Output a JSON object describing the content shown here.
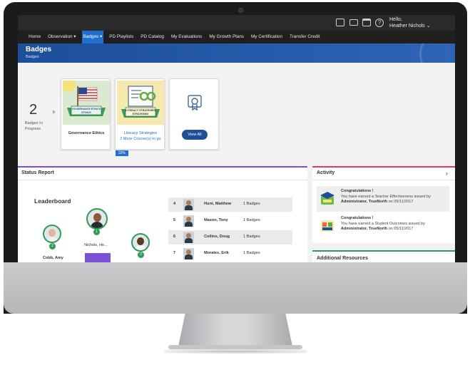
{
  "topbar": {
    "greeting": "Hello,",
    "user_name": "Heather Nichols",
    "help_glyph": "?"
  },
  "nav": {
    "items": [
      {
        "label": "Home"
      },
      {
        "label": "Observation ▾"
      },
      {
        "label": "Badges ▾",
        "active": true
      },
      {
        "label": "PD Playlists"
      },
      {
        "label": "PD Catalog"
      },
      {
        "label": "My Evaluations"
      },
      {
        "label": "My Growth Plans"
      },
      {
        "label": "My Certification"
      },
      {
        "label": "Transfer Credit"
      }
    ]
  },
  "banner": {
    "title": "Badges",
    "breadcrumb": "Badges"
  },
  "badges_in_progress": {
    "count": "2",
    "label": "Badges In Progress"
  },
  "badge_cards": [
    {
      "name": "Governance Ethics",
      "ribbon": "GOVERNANCE ETHICS"
    },
    {
      "name": "Literacy Strategies",
      "note": "2 More Course(s) to go",
      "progress": "33%",
      "ribbon": "LITERACY STRATEGIES"
    }
  ],
  "view_all": {
    "label": "View All"
  },
  "status_report": {
    "title": "Status Report",
    "leaderboard_title": "Leaderboard",
    "podium": [
      {
        "rank": "1",
        "name": "Nichols, He..."
      },
      {
        "rank": "2",
        "name": "Cobb, Amy"
      },
      {
        "rank": "3",
        "name": ""
      }
    ],
    "ranking": [
      {
        "rank": "4",
        "name": "Hunt, Matthew",
        "badges": "1 Badges"
      },
      {
        "rank": "5",
        "name": "Mason, Tony",
        "badges": "1 Badges"
      },
      {
        "rank": "6",
        "name": "Collins, Doug",
        "badges": "1 Badges"
      },
      {
        "rank": "7",
        "name": "Morales, Erik",
        "badges": "1 Badges"
      }
    ]
  },
  "activity": {
    "title": "Activity",
    "arrow": "›",
    "items": [
      {
        "headline": "Congratulations !",
        "text": "You have earned a Teacher Effectiveness issued by",
        "issuer": "Administrator, TrueNorth",
        "date_text": "on 05/11/2017"
      },
      {
        "headline": "Congratulations !",
        "text": "You have earned a Student Outcomes issued by",
        "issuer": "Administrator, TrueNorth",
        "date_text": "on 05/11/2017"
      }
    ]
  },
  "resources": {
    "title": "Additional Resources"
  },
  "colors": {
    "nav_active": "#1e6fcf",
    "banner": "#1b4f9c",
    "status_accent": "#7b4fd6",
    "activity_accent": "#e23b57",
    "resources_accent": "#2f9b55"
  }
}
